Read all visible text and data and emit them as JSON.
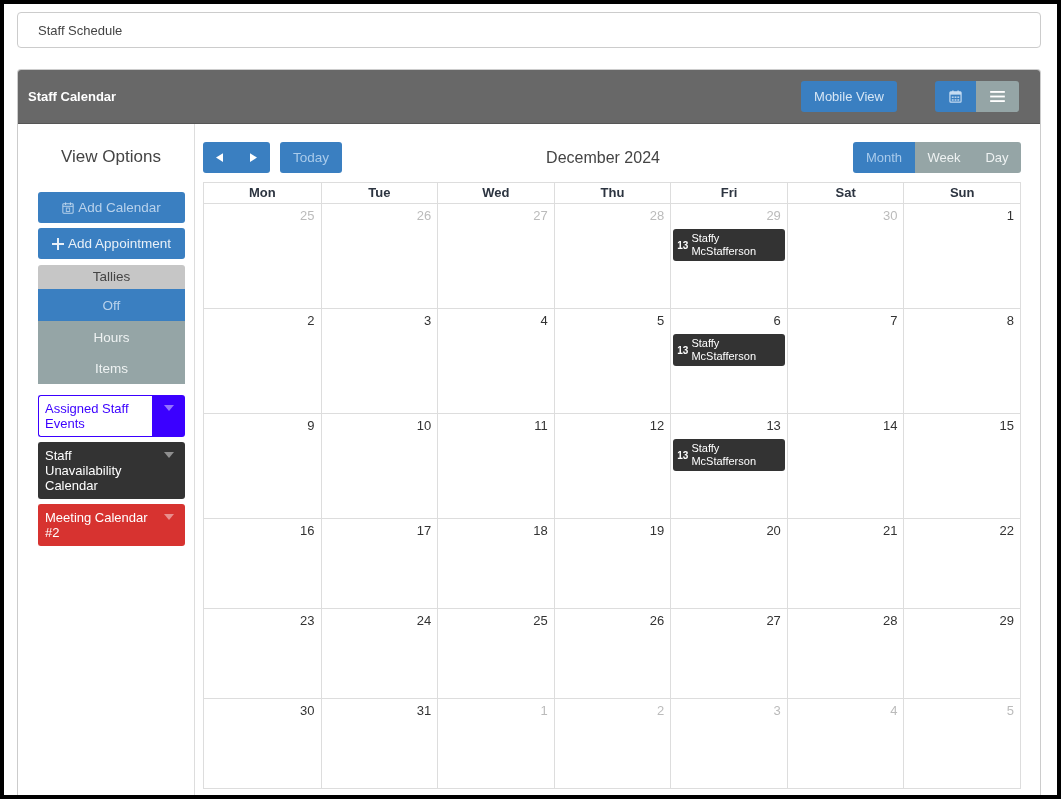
{
  "page_title": "Staff Schedule",
  "panel": {
    "title": "Staff Calendar",
    "mobile_button": "Mobile View",
    "view_toggle": [
      {
        "kind": "calendar",
        "selected": true
      },
      {
        "kind": "list",
        "selected": false
      }
    ]
  },
  "sidebar": {
    "title": "View Options",
    "buttons": [
      {
        "kind": "calendar",
        "label": "Add Calendar",
        "disabled": true
      },
      {
        "kind": "plus",
        "label": "Add Appointment",
        "disabled": false
      }
    ],
    "tallies": {
      "title": "Tallies",
      "options": [
        {
          "label": "Off",
          "selected": true
        },
        {
          "label": "Hours",
          "selected": false
        },
        {
          "label": "Items",
          "selected": false
        }
      ]
    },
    "calendars": [
      {
        "label": "Assigned Staff Events",
        "color": "#3b00ff",
        "selected": true
      },
      {
        "label": "Staff Unavailability Calendar",
        "color": "#333333",
        "selected": false
      },
      {
        "label": "Meeting Calendar #2",
        "color": "#d73330",
        "selected": false
      }
    ]
  },
  "calendar": {
    "today_button": {
      "label": "Today",
      "disabled": true
    },
    "title": "December 2024",
    "views": [
      {
        "label": "Month",
        "selected": true
      },
      {
        "label": "Week",
        "selected": false
      },
      {
        "label": "Day",
        "selected": false
      }
    ],
    "weekdays": [
      "Mon",
      "Tue",
      "Wed",
      "Thu",
      "Fri",
      "Sat",
      "Sun"
    ],
    "weeks": [
      [
        {
          "day": "25",
          "outside": true
        },
        {
          "day": "26",
          "outside": true
        },
        {
          "day": "27",
          "outside": true
        },
        {
          "day": "28",
          "outside": true
        },
        {
          "day": "29",
          "outside": true,
          "events": [
            {
              "number": "13",
              "title": "Staffy McStafferson"
            }
          ]
        },
        {
          "day": "30",
          "outside": true
        },
        {
          "day": "1",
          "outside": false
        }
      ],
      [
        {
          "day": "2",
          "outside": false
        },
        {
          "day": "3",
          "outside": false
        },
        {
          "day": "4",
          "outside": false
        },
        {
          "day": "5",
          "outside": false
        },
        {
          "day": "6",
          "outside": false,
          "events": [
            {
              "number": "13",
              "title": "Staffy McStafferson"
            }
          ]
        },
        {
          "day": "7",
          "outside": false
        },
        {
          "day": "8",
          "outside": false
        }
      ],
      [
        {
          "day": "9",
          "outside": false
        },
        {
          "day": "10",
          "outside": false
        },
        {
          "day": "11",
          "outside": false
        },
        {
          "day": "12",
          "outside": false
        },
        {
          "day": "13",
          "outside": false,
          "events": [
            {
              "number": "13",
              "title": "Staffy McStafferson"
            }
          ]
        },
        {
          "day": "14",
          "outside": false
        },
        {
          "day": "15",
          "outside": false
        }
      ],
      [
        {
          "day": "16",
          "outside": false
        },
        {
          "day": "17",
          "outside": false
        },
        {
          "day": "18",
          "outside": false
        },
        {
          "day": "19",
          "outside": false
        },
        {
          "day": "20",
          "outside": false
        },
        {
          "day": "21",
          "outside": false
        },
        {
          "day": "22",
          "outside": false
        }
      ],
      [
        {
          "day": "23",
          "outside": false
        },
        {
          "day": "24",
          "outside": false
        },
        {
          "day": "25",
          "outside": false
        },
        {
          "day": "26",
          "outside": false
        },
        {
          "day": "27",
          "outside": false
        },
        {
          "day": "28",
          "outside": false
        },
        {
          "day": "29",
          "outside": false
        }
      ],
      [
        {
          "day": "30",
          "outside": false
        },
        {
          "day": "31",
          "outside": false
        },
        {
          "day": "1",
          "outside": true
        },
        {
          "day": "2",
          "outside": true
        },
        {
          "day": "3",
          "outside": true
        },
        {
          "day": "4",
          "outside": true
        },
        {
          "day": "5",
          "outside": true
        }
      ]
    ]
  }
}
